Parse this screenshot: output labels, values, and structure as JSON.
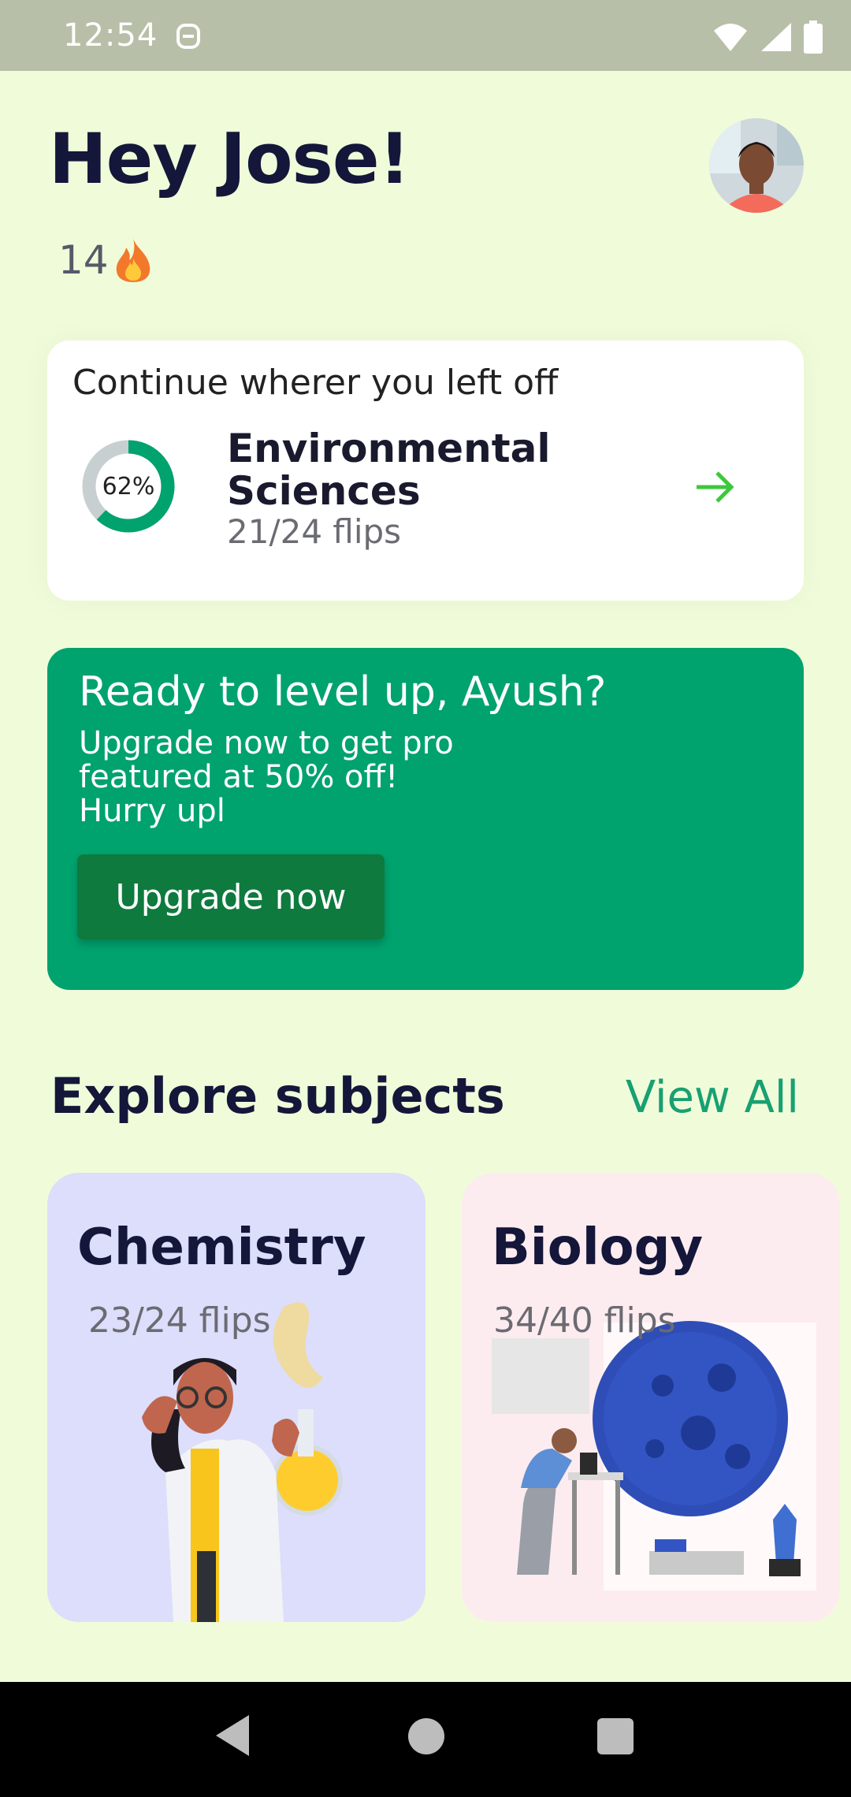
{
  "status_bar": {
    "time": "12:54"
  },
  "header": {
    "greeting": "Hey Jose!",
    "streak_count": "14",
    "streak_icon": "fire-icon"
  },
  "continue_card": {
    "title": "Continue wherer you left off",
    "progress_label": "62%",
    "progress": 0.62,
    "subject": "Environmental Sciences",
    "flips": "21/24 flips",
    "accent": "#00a26e"
  },
  "promo": {
    "title": "Ready to level up, Ayush?",
    "body_line1": "Upgrade now to get pro",
    "body_line2": "featured at 50% off!",
    "body_line3": "Hurry upl",
    "button_label": "Upgrade now",
    "background": "#00a26e"
  },
  "explore": {
    "title": "Explore subjects",
    "view_all": "View All",
    "subjects": [
      {
        "name": "Chemistry",
        "flips": "23/24 flips",
        "background": "#dcdefb"
      },
      {
        "name": "Biology",
        "flips": "34/40 flips",
        "background": "#fdecef"
      }
    ]
  },
  "colors": {
    "page_bg": "#f0fcd9",
    "arrow": "#3cc83c",
    "link": "#18a072"
  }
}
